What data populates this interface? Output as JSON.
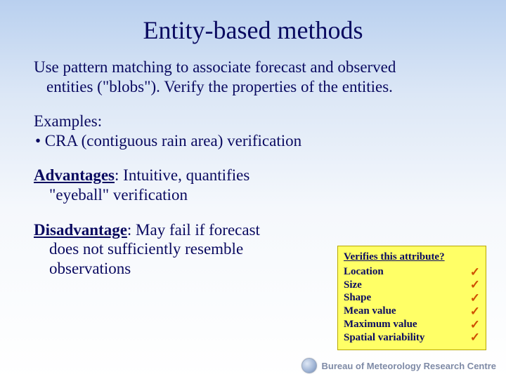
{
  "title": "Entity-based methods",
  "intro": {
    "line1": "Use pattern matching to associate forecast and observed",
    "line2": "entities (\"blobs\"). Verify the properties of the entities."
  },
  "examples": {
    "heading": "Examples:",
    "bullet1": "• CRA (contiguous rain area) verification"
  },
  "advantages": {
    "label": "Advantages",
    "rest1": ": Intuitive, quantifies",
    "line2": "\"eyeball\" verification"
  },
  "disadvantage": {
    "label": "Disadvantage",
    "rest1": ": May fail if forecast",
    "line2": "does not sufficiently resemble",
    "line3": "observations"
  },
  "attributes": {
    "header": "Verifies this attribute?",
    "rows": [
      {
        "label": "Location",
        "check": true
      },
      {
        "label": "Size",
        "check": true
      },
      {
        "label": "Shape",
        "check": true
      },
      {
        "label": "Mean value",
        "check": true
      },
      {
        "label": "Maximum value",
        "check": true
      },
      {
        "label": "Spatial variability",
        "check": true
      }
    ]
  },
  "footer": {
    "text": "Bureau of Meteorology Research Centre"
  },
  "checkmark_glyph": "✓"
}
